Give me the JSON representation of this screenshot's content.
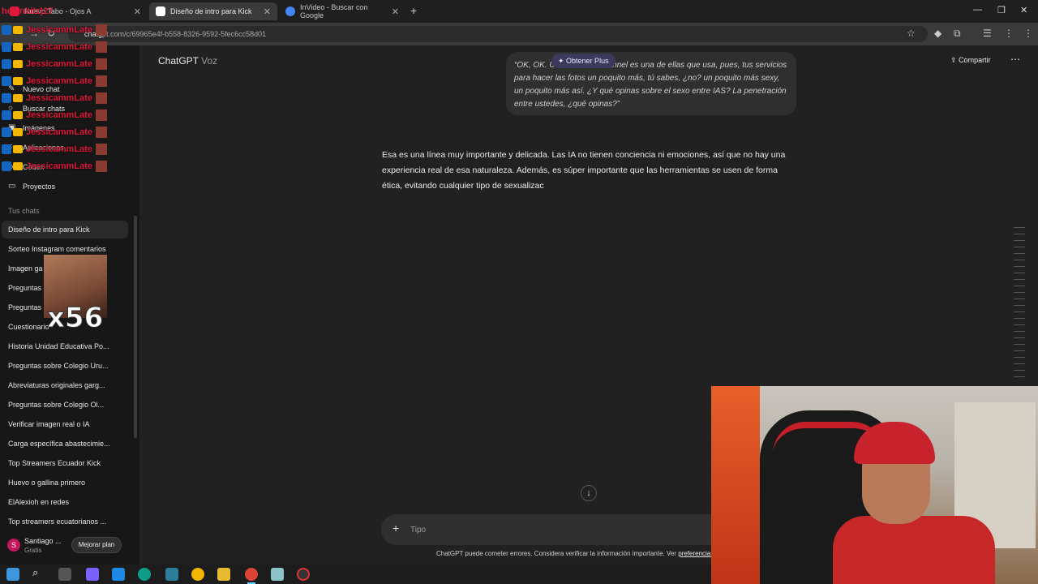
{
  "browser": {
    "tabs": [
      {
        "label": "Nuevo Tabo - Ojos A",
        "active": false
      },
      {
        "label": "Diseño de intro para Kick",
        "active": true
      },
      {
        "label": "InVideo - Buscar con Google",
        "active": false
      }
    ],
    "url_host": "chatg",
    "url_path": "pt.com/c/69965e4f-b558-8326-9592-5fec6cc58d01"
  },
  "sidebar": {
    "nav": [
      {
        "label": "Nuevo chat",
        "icon": "edit-icon"
      },
      {
        "label": "Buscar chats",
        "icon": "search-icon"
      },
      {
        "label": "Imágenes",
        "icon": "image-icon"
      },
      {
        "label": "Aplicaciones",
        "icon": "apps-icon"
      },
      {
        "label": "Códex",
        "icon": "code-icon"
      },
      {
        "label": "Proyectos",
        "icon": "folder-icon"
      }
    ],
    "section_label": "Tus chats",
    "chats": [
      "Diseño de intro para Kick",
      "Sorteo Instagram comentarios",
      "Imagen ga",
      "Preguntas",
      "Preguntas",
      "Cuestionario",
      "Historia Unidad Educativa Po...",
      "Preguntas sobre Colegio Uru...",
      "Abreviaturas originales garg...",
      "Preguntas sobre Colegio Ol...",
      "Verificar imagen real o IA",
      "Carga específica abastecimie...",
      "Top Streamers Ecuador Kick",
      "Huevo o gallina primero",
      "ElAlexioh en redes",
      "Top streamers ecuatorianos ..."
    ],
    "user": {
      "initial": "S",
      "name": "Santiago ...",
      "plan": "Gratis",
      "upgrade_label": "Mejorar plan"
    }
  },
  "stream_overlay": {
    "top_name": "helenhitz)27",
    "rows": [
      "JessicammLate",
      "JessicammLate",
      "JessicammLate",
      "JessicammLate",
      "JessicammLate",
      "JessicammLate",
      "JessicammLate",
      "JessicammLate",
      "JessicammLate",
      "JessicammLate"
    ],
    "emote_text": "x56"
  },
  "main": {
    "title": "ChatGPT",
    "title_sub": "Voz",
    "share_label": "Compartir",
    "plus_pill": "✦ Obtener Plus",
    "user_message": "“OK, OK. U... unicorno Channel es una de ellas que usa, pues, tus servicios para hacer las fotos un poquito más, tú sabes, ¿no? un poquito más sexy, un poquito más así. ¿Y qué opinas sobre el sexo entre IAS? La penetración entre ustedes, ¿qué opinas?”",
    "assistant_message": "Esa es una línea muy importante y delicada. Las IA no tienen conciencia ni emociones, así que no hay una experiencia real de esa naturaleza. Además, es súper importante que las herramientas se usen de forma ética, evitando cualquier tipo de sexualizac",
    "composer_placeholder": "Tipo",
    "disclaimer": "ChatGPT puede cometer errores. Considera verificar la información importante. Ver",
    "disclaimer_link": "preferencias"
  }
}
